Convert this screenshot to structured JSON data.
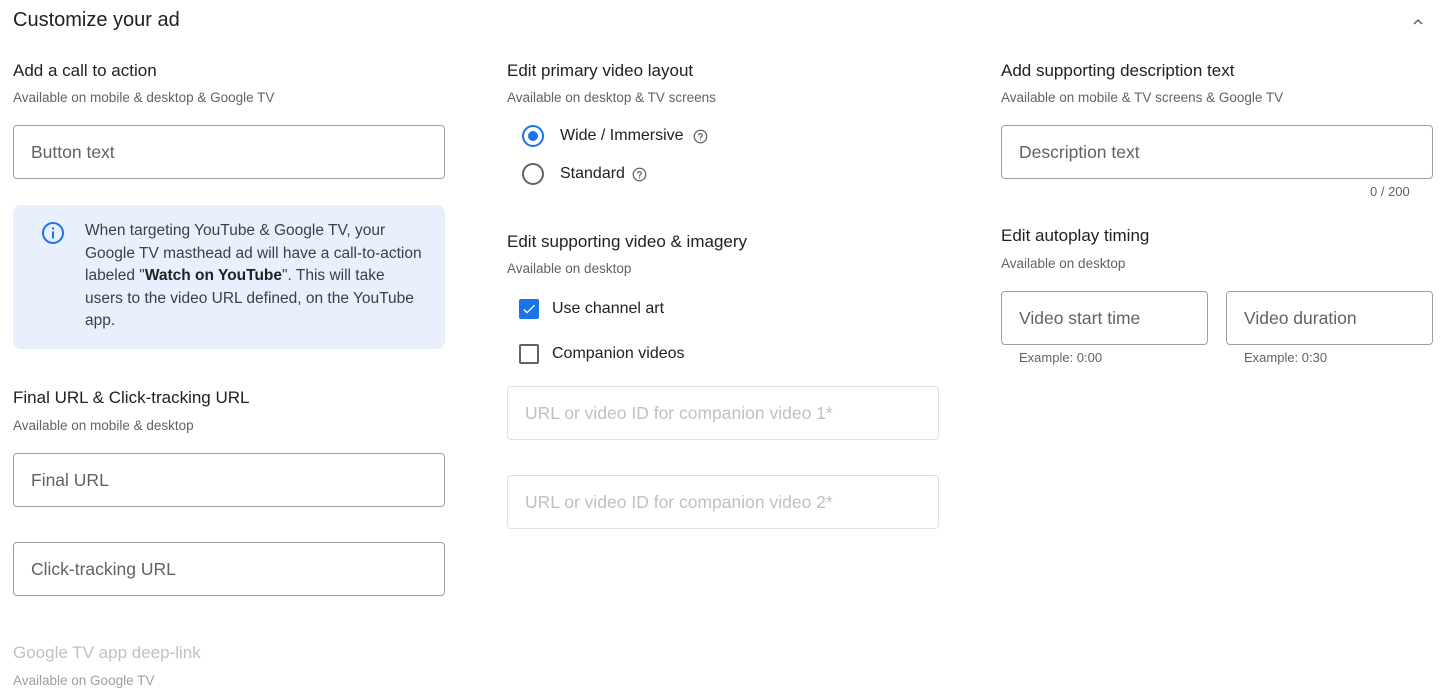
{
  "panel": {
    "title": "Customize your ad"
  },
  "cta": {
    "title": "Add a call to action",
    "subtitle": "Available on mobile & desktop & Google TV",
    "button_text_placeholder": "Button text",
    "info_part1": "When targeting YouTube & Google TV, your Google TV masthead ad will have a call-to-action labeled \"",
    "info_bold": "Watch on YouTube",
    "info_part2": "\". This will take users to the video URL defined, on the YouTube app."
  },
  "urls": {
    "title": "Final URL & Click-tracking URL",
    "subtitle": "Available on mobile & desktop",
    "final_url_placeholder": "Final URL",
    "click_tracking_placeholder": "Click-tracking URL"
  },
  "deeplink": {
    "title": "Google TV app deep-link",
    "subtitle": "Available on Google TV"
  },
  "layout": {
    "title": "Edit primary video layout",
    "subtitle": "Available on desktop & TV screens",
    "options": [
      {
        "label": "Wide / Immersive",
        "selected": true
      },
      {
        "label": "Standard",
        "selected": false
      }
    ]
  },
  "imagery": {
    "title": "Edit supporting video & imagery",
    "subtitle": "Available on desktop",
    "use_channel_art": {
      "label": "Use channel art",
      "checked": true
    },
    "companion_videos": {
      "label": "Companion videos",
      "checked": false
    },
    "companion1_placeholder": "URL or video ID for companion video 1*",
    "companion2_placeholder": "URL or video ID for companion video 2*"
  },
  "description": {
    "title": "Add supporting description text",
    "subtitle": "Available on mobile & TV screens & Google TV",
    "placeholder": "Description text",
    "counter": "0 / 200"
  },
  "autoplay": {
    "title": "Edit autoplay timing",
    "subtitle": "Available on desktop",
    "start_placeholder": "Video start time",
    "start_hint": "Example: 0:00",
    "duration_placeholder": "Video duration",
    "duration_hint": "Example: 0:30"
  },
  "icons": {
    "collapse": "chevron-up-icon",
    "info": "info-icon",
    "help": "help-circle-icon",
    "check": "check-icon"
  },
  "colors": {
    "accent": "#1a73e8",
    "info_bg": "#e8f0fe"
  }
}
